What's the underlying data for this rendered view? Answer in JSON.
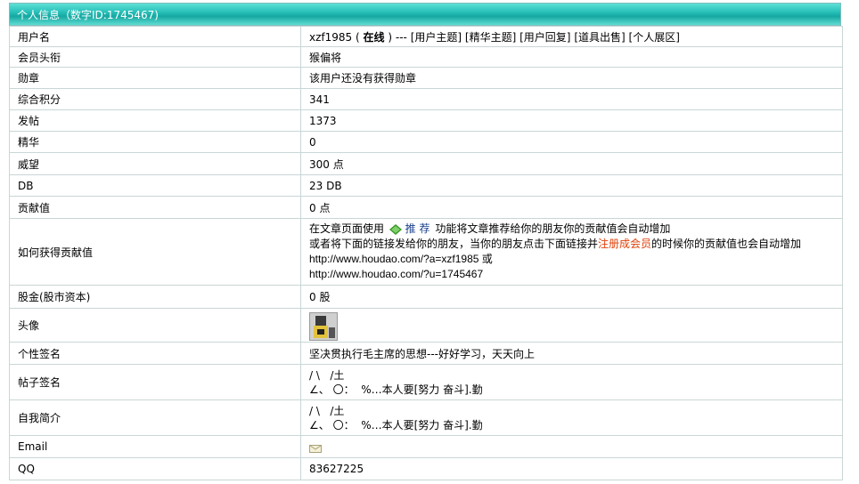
{
  "header": {
    "title": "个人信息（数字ID:1745467)"
  },
  "rows": {
    "username": {
      "label": "用户名",
      "name": "xzf1985",
      "status_open": "(",
      "status": "在线",
      "status_close": ")",
      "sep": "---",
      "links": [
        "[用户主题]",
        "[精华主题]",
        "[用户回复]",
        "[道具出售]",
        "[个人展区]"
      ]
    },
    "title": {
      "label": "会员头衔",
      "value": "猴偏将"
    },
    "medal": {
      "label": "勋章",
      "value": "该用户还没有获得勋章"
    },
    "points": {
      "label": "综合积分",
      "value": "341"
    },
    "posts": {
      "label": "发帖",
      "value": "1373"
    },
    "digest": {
      "label": "精华",
      "value": "0"
    },
    "prestige": {
      "label": "威望",
      "value": "300 点"
    },
    "db": {
      "label": "DB",
      "value": "23 DB"
    },
    "contribution": {
      "label": "贡献值",
      "value": "0 点"
    },
    "how": {
      "label": "如何获得贡献值",
      "line1_pre": "在文章页面使用",
      "recommend": "推 荐",
      "line1_post": "功能将文章推荐给你的朋友你的贡献值会自动增加",
      "line2_pre": "或者将下面的链接发给你的朋友，当你的朋友点击下面链接并",
      "line2_link": "注册成会员",
      "line2_post": "的时候你的贡献值也会自动增加",
      "url1": "http://www.houdao.com/?a=xzf1985",
      "url1_or": "或",
      "url2": "http://www.houdao.com/?u=1745467"
    },
    "stock": {
      "label": "股金(股市资本)",
      "value": "0 股"
    },
    "avatar": {
      "label": "头像"
    },
    "signature": {
      "label": "个性签名",
      "value": "坚决贯执行毛主席的思想---好好学习，天天向上"
    },
    "post_sig": {
      "label": "帖子签名",
      "line1": "/ \\   /土",
      "line2": "∠、 〇：  %…本人要[努力 奋斗].勤"
    },
    "intro": {
      "label": "自我简介",
      "line1": "/ \\   /土",
      "line2": "∠、 〇：  %…本人要[努力 奋斗].勤"
    },
    "email": {
      "label": "Email",
      "icon": "envelope-icon"
    },
    "qq": {
      "label": "QQ",
      "value": "83627225"
    }
  }
}
